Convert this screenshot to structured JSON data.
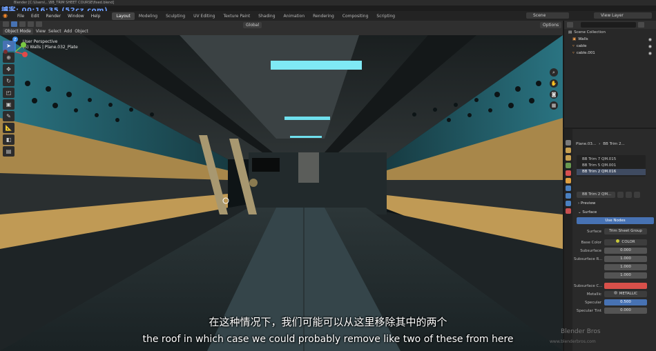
{
  "window": {
    "title": "Blender [C:\\Users\\...\\BB_TRIM SHEET COURSE\\fixed.blend]",
    "watermark_top": "搏客: 00:16:35 (52cz.com)"
  },
  "menu": {
    "items": [
      "File",
      "Edit",
      "Render",
      "Window",
      "Help"
    ],
    "workspaces": [
      "Layout",
      "Modeling",
      "Sculpting",
      "UV Editing",
      "Texture Paint",
      "Shading",
      "Animation",
      "Rendering",
      "Compositing",
      "Scripting"
    ],
    "active_workspace": "Layout",
    "scene": "Scene",
    "view_layer": "View Layer"
  },
  "viewport_header": {
    "mode": "Object Mode",
    "menus": [
      "View",
      "Select",
      "Add",
      "Object"
    ],
    "orientation": "Global",
    "options": "Options"
  },
  "viewport": {
    "perspective": "User Perspective",
    "object_info": "(5) Walls | Plane.032_Plate",
    "gizmo": {
      "x_color": "#e04a4a",
      "y_color": "#7ac943",
      "z_color": "#3d8ee8",
      "z_label": "Z"
    }
  },
  "outliner": {
    "root": "Scene Collection",
    "items": [
      {
        "label": "Walls"
      },
      {
        "label": "cable"
      },
      {
        "label": "cable.001"
      }
    ]
  },
  "properties": {
    "object": "Plane.03...",
    "material_header": "BB Trim 2...",
    "slots": [
      {
        "label": "BB Trim 7 QM.015"
      },
      {
        "label": "BB Trim 5 QM.001"
      },
      {
        "label": "BB Trim 2 QM.016"
      }
    ],
    "active_material": "BB Trim 2 QM...",
    "preview_label": "Preview",
    "surface_label": "Surface",
    "use_nodes_label": "Use Nodes",
    "fields": {
      "surface": {
        "label": "Surface",
        "value": "Trim Sheet Group"
      },
      "base_color": {
        "label": "Base Color",
        "value": "COLOR"
      },
      "subsurface": {
        "label": "Subsurface",
        "value": "0.000"
      },
      "subsurface_r_label": "Subsurface R...",
      "subsurface_r_values": [
        "1.000",
        "1.000",
        "1.000"
      ],
      "subsurface_c": {
        "label": "Subsurface C..."
      },
      "metallic": {
        "label": "Metallic",
        "value": "METALLIC"
      },
      "specular": {
        "label": "Specular",
        "value": "0.500"
      },
      "specular_tint": {
        "label": "Specular Tint",
        "value": "0.000"
      }
    },
    "colors": {
      "subsurface_color": "#d8504a"
    }
  },
  "subtitles": {
    "chinese": "在这种情况下，我们可能可以从这里移除其中的两个",
    "english": "the roof in which case we could probably remove like two of these from here"
  },
  "branding": {
    "watermark_bottom": "Blender Bros",
    "watermark_bottom_small": "www.blenderbros.com"
  }
}
